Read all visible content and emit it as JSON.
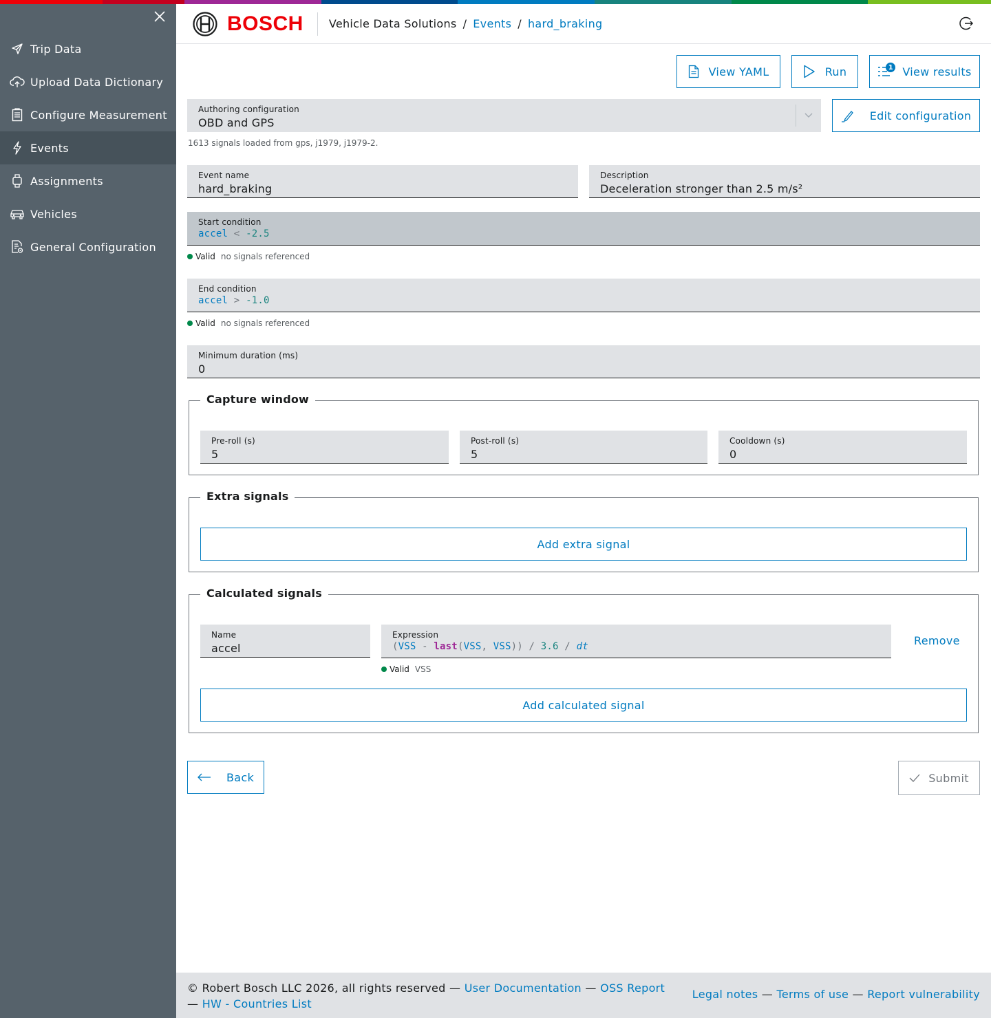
{
  "colors": {
    "sidebar_bg": "#56626b",
    "sidebar_active": "#46525a",
    "accent": "#007bc0",
    "brand_red": "#ed0007",
    "field_bg": "#e0e2e5",
    "valid_green": "#00884a"
  },
  "supergraphic": [
    "#ed0007",
    "#9e2896",
    "#004b8d",
    "#007bc0",
    "#18837e",
    "#00884a",
    "#78be20"
  ],
  "sidebar": {
    "close_icon": "close-icon",
    "items": [
      {
        "label": "Trip Data",
        "icon": "send-icon"
      },
      {
        "label": "Upload Data Dictionary",
        "icon": "cloud-upload-icon"
      },
      {
        "label": "Configure Measurement",
        "icon": "clipboard-icon"
      },
      {
        "label": "Events",
        "icon": "lightning-icon",
        "active": true
      },
      {
        "label": "Assignments",
        "icon": "watch-icon"
      },
      {
        "label": "Vehicles",
        "icon": "car-icon"
      },
      {
        "label": "General Configuration",
        "icon": "document-settings-icon"
      }
    ]
  },
  "header": {
    "brand": "BOSCH",
    "breadcrumb": [
      "Vehicle Data Solutions",
      "Events",
      "hard_braking"
    ],
    "logout_icon": "logout-icon"
  },
  "toolbar": {
    "view_yaml": "View YAML",
    "run": "Run",
    "view_results": "View results",
    "results_badge": "1",
    "edit_configuration": "Edit configuration"
  },
  "authoring": {
    "label": "Authoring configuration",
    "value": "OBD and GPS",
    "hint": "1613 signals loaded from gps, j1979, j1979-2."
  },
  "event_name": {
    "label": "Event name",
    "value": "hard_braking"
  },
  "description": {
    "label": "Description",
    "value": "Deceleration stronger than 2.5 m/s²"
  },
  "start_condition": {
    "label": "Start condition",
    "signal": "accel",
    "op": "<",
    "value": "-2.5",
    "status": "Valid",
    "detail": "no signals referenced"
  },
  "end_condition": {
    "label": "End condition",
    "signal": "accel",
    "op": ">",
    "value": "-1.0",
    "status": "Valid",
    "detail": "no signals referenced"
  },
  "min_duration": {
    "label": "Minimum duration (ms)",
    "value": "0"
  },
  "capture_window": {
    "title": "Capture window",
    "fields": [
      {
        "label": "Pre-roll (s)",
        "value": "5"
      },
      {
        "label": "Post-roll (s)",
        "value": "5"
      },
      {
        "label": "Cooldown (s)",
        "value": "0"
      }
    ]
  },
  "extra_signals": {
    "title": "Extra signals",
    "add_label": "Add extra signal"
  },
  "calculated_signals": {
    "title": "Calculated signals",
    "name_label": "Name",
    "name_value": "accel",
    "expr_label": "Expression",
    "expr": {
      "open": "(",
      "vss1": "VSS",
      "minus": " - ",
      "fn": "last",
      "open2": "(",
      "vss2": "VSS",
      "comma": ", ",
      "vss3": "VSS",
      "close": "))",
      "div1": " / ",
      "num": "3.6",
      "div2": " / ",
      "dt": "dt"
    },
    "status": "Valid",
    "detail": "VSS",
    "remove": "Remove",
    "add_label": "Add calculated signal"
  },
  "nav_buttons": {
    "back": "Back",
    "submit": "Submit"
  },
  "footer": {
    "copyright": "© Robert Bosch LLC 2026, all rights reserved",
    "sep": " — ",
    "left_links": [
      "User Documentation",
      "OSS Report",
      "HW - Countries List"
    ],
    "right_links": [
      "Legal notes",
      "Terms of use",
      "Report vulnerability"
    ]
  }
}
